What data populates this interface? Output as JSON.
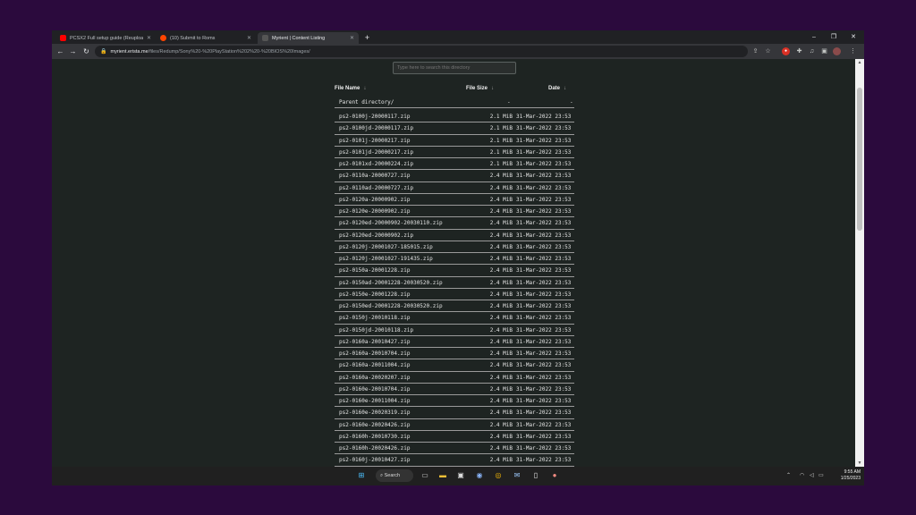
{
  "tabs": [
    {
      "title": "PCSX2 Full setup guide (Reupload",
      "active": false,
      "favicon_color": "#ff0000"
    },
    {
      "title": "(10) Submit to Roms",
      "active": false,
      "favicon_color": "#ff4500"
    },
    {
      "title": "Myrient | Content Listing",
      "active": true,
      "favicon_color": "#555555"
    }
  ],
  "address": {
    "host": "myrient.erista.me",
    "path": "/files/Redump/Sony%20-%20PlayStation%202%20-%20BIOS%20Images/"
  },
  "search": {
    "placeholder": "Type here to search this directory"
  },
  "columns": {
    "name": "File Name",
    "size": "File Size",
    "date": "Date",
    "sort_arrow": "↓"
  },
  "parent": {
    "name": "Parent directory/",
    "size": "-",
    "date": "-"
  },
  "files": [
    {
      "name": "ps2-0100j-20000117.zip",
      "size": "2.1 MiB",
      "date": "31-Mar-2022 23:53"
    },
    {
      "name": "ps2-0100jd-20000117.zip",
      "size": "2.1 MiB",
      "date": "31-Mar-2022 23:53"
    },
    {
      "name": "ps2-0101j-20000217.zip",
      "size": "2.1 MiB",
      "date": "31-Mar-2022 23:53"
    },
    {
      "name": "ps2-0101jd-20000217.zip",
      "size": "2.1 MiB",
      "date": "31-Mar-2022 23:53"
    },
    {
      "name": "ps2-0101xd-20000224.zip",
      "size": "2.1 MiB",
      "date": "31-Mar-2022 23:53"
    },
    {
      "name": "ps2-0110a-20000727.zip",
      "size": "2.4 MiB",
      "date": "31-Mar-2022 23:53"
    },
    {
      "name": "ps2-0110ad-20000727.zip",
      "size": "2.4 MiB",
      "date": "31-Mar-2022 23:53"
    },
    {
      "name": "ps2-0120a-20000902.zip",
      "size": "2.4 MiB",
      "date": "31-Mar-2022 23:53"
    },
    {
      "name": "ps2-0120e-20000902.zip",
      "size": "2.4 MiB",
      "date": "31-Mar-2022 23:53"
    },
    {
      "name": "ps2-0120ed-20000902-20030110.zip",
      "size": "2.4 MiB",
      "date": "31-Mar-2022 23:53"
    },
    {
      "name": "ps2-0120ed-20000902.zip",
      "size": "2.4 MiB",
      "date": "31-Mar-2022 23:53"
    },
    {
      "name": "ps2-0120j-20001027-185015.zip",
      "size": "2.4 MiB",
      "date": "31-Mar-2022 23:53"
    },
    {
      "name": "ps2-0120j-20001027-191435.zip",
      "size": "2.4 MiB",
      "date": "31-Mar-2022 23:53"
    },
    {
      "name": "ps2-0150a-20001228.zip",
      "size": "2.4 MiB",
      "date": "31-Mar-2022 23:53"
    },
    {
      "name": "ps2-0150ad-20001228-20030520.zip",
      "size": "2.4 MiB",
      "date": "31-Mar-2022 23:53"
    },
    {
      "name": "ps2-0150e-20001228.zip",
      "size": "2.4 MiB",
      "date": "31-Mar-2022 23:53"
    },
    {
      "name": "ps2-0150ed-20001228-20030520.zip",
      "size": "2.4 MiB",
      "date": "31-Mar-2022 23:53"
    },
    {
      "name": "ps2-0150j-20010118.zip",
      "size": "2.4 MiB",
      "date": "31-Mar-2022 23:53"
    },
    {
      "name": "ps2-0150jd-20010118.zip",
      "size": "2.4 MiB",
      "date": "31-Mar-2022 23:53"
    },
    {
      "name": "ps2-0160a-20010427.zip",
      "size": "2.4 MiB",
      "date": "31-Mar-2022 23:53"
    },
    {
      "name": "ps2-0160a-20010704.zip",
      "size": "2.4 MiB",
      "date": "31-Mar-2022 23:53"
    },
    {
      "name": "ps2-0160a-20011004.zip",
      "size": "2.4 MiB",
      "date": "31-Mar-2022 23:53"
    },
    {
      "name": "ps2-0160a-20020207.zip",
      "size": "2.4 MiB",
      "date": "31-Mar-2022 23:53"
    },
    {
      "name": "ps2-0160e-20010704.zip",
      "size": "2.4 MiB",
      "date": "31-Mar-2022 23:53"
    },
    {
      "name": "ps2-0160e-20011004.zip",
      "size": "2.4 MiB",
      "date": "31-Mar-2022 23:53"
    },
    {
      "name": "ps2-0160e-20020319.zip",
      "size": "2.4 MiB",
      "date": "31-Mar-2022 23:53"
    },
    {
      "name": "ps2-0160e-20020426.zip",
      "size": "2.4 MiB",
      "date": "31-Mar-2022 23:53"
    },
    {
      "name": "ps2-0160h-20010730.zip",
      "size": "2.4 MiB",
      "date": "31-Mar-2022 23:53"
    },
    {
      "name": "ps2-0160h-20020426.zip",
      "size": "2.4 MiB",
      "date": "31-Mar-2022 23:53"
    },
    {
      "name": "ps2-0160j-20010427.zip",
      "size": "2.4 MiB",
      "date": "31-Mar-2022 23:53"
    }
  ],
  "taskbar": {
    "search_label": "Search",
    "time": "9:55 AM",
    "date": "1/25/2023"
  },
  "colors": {
    "accent": "#8ab4f8",
    "page_bg": "#1e2422",
    "desktop_bg": "#2b0a3d"
  }
}
